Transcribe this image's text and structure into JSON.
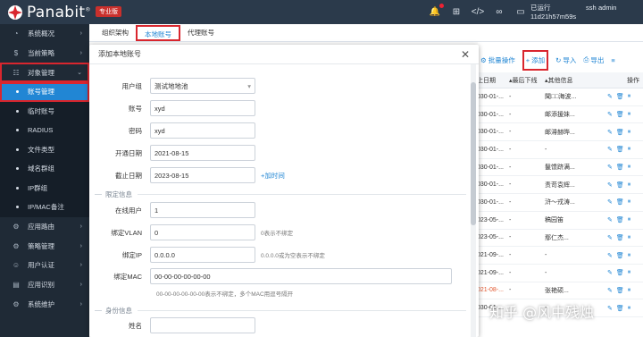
{
  "header": {
    "logo_text": "Panabit",
    "logo_reg": "®",
    "edition": "专业版",
    "status_line1": "已运行",
    "status_line2": "11d21h57m59s",
    "user_line1": "ssh",
    "user_line2": "admin"
  },
  "sidebar": {
    "items": [
      {
        "label": "系统概况",
        "icon": "speedometer-icon"
      },
      {
        "label": "当前策略",
        "icon": "dollar-icon"
      },
      {
        "label": "对象管理",
        "icon": "database-icon"
      }
    ],
    "subitems": [
      "账号管理",
      "临时账号",
      "RADIUS",
      "文件类型",
      "域名群组",
      "IP群组",
      "IP/MAC备注"
    ],
    "bottom_items": [
      {
        "label": "应用路由",
        "icon": "gear-icon"
      },
      {
        "label": "策略管理",
        "icon": "gear-icon"
      },
      {
        "label": "用户认证",
        "icon": "user-icon"
      },
      {
        "label": "应用识别",
        "icon": "document-icon"
      },
      {
        "label": "系统维护",
        "icon": "cog-icon"
      }
    ]
  },
  "tabs": [
    "组织架构",
    "本地账号",
    "代理账号"
  ],
  "grid": {
    "toolbar": {
      "batch": "批量操作",
      "add": "添加",
      "import": "导入",
      "export": "导出"
    },
    "headers": [
      "止日期",
      "最后下线",
      "其他信息",
      "操作"
    ],
    "rows": [
      {
        "date": "030-01-...",
        "last": "-",
        "info": "聞□□海波..."
      },
      {
        "date": "030-01-...",
        "last": "-",
        "info": "邮添援妹..."
      },
      {
        "date": "030-01-...",
        "last": "-",
        "info": "邮滞赫晔..."
      },
      {
        "date": "030-01-...",
        "last": "-",
        "info": "-"
      },
      {
        "date": "030-01-...",
        "last": "-",
        "info": "鬣馈跻满..."
      },
      {
        "date": "030-01-...",
        "last": "-",
        "info": "责苛袁辉..."
      },
      {
        "date": "030-01-...",
        "last": "-",
        "info": "浒〜戎涛..."
      },
      {
        "date": "023-05-...",
        "last": "-",
        "info": "稿园笛"
      },
      {
        "date": "023-05-...",
        "last": "-",
        "info": "鄢仁杰..."
      },
      {
        "date": "021-09-...",
        "last": "-",
        "info": "-"
      },
      {
        "date": "021-09-...",
        "last": "-",
        "info": "-"
      },
      {
        "date": "021-08-...",
        "last": "-",
        "info": "张艳硕..."
      },
      {
        "date": "030-01-...",
        "last": "-",
        "info": "-"
      }
    ]
  },
  "modal": {
    "title": "添加本地账号",
    "group_label": "用户组",
    "group_value": "测试地地池",
    "account_label": "账号",
    "account_value": "xyd",
    "password_label": "密码",
    "password_value": "xyd",
    "open_label": "开通日期",
    "open_value": "2021-08-15",
    "expire_label": "截止日期",
    "expire_value": "2023-08-15",
    "add_time": "加时间",
    "limit_section": "限定信息",
    "online_label": "在线用户",
    "online_value": "1",
    "vlan_label": "绑定VLAN",
    "vlan_value": "0",
    "vlan_hint": "0表示不绑定",
    "ip_label": "绑定IP",
    "ip_value": "0.0.0.0",
    "ip_hint": "0.0.0.0或为空表示不绑定",
    "mac_label": "绑定MAC",
    "mac_value": "00-00-00-00-00-00",
    "mac_hint": "00-00-00-00-00-00表示不绑定，多个MAC用逗号隔开",
    "identity_section": "身份信息",
    "name_label": "姓名"
  },
  "watermark": "知乎 @风中残烛"
}
